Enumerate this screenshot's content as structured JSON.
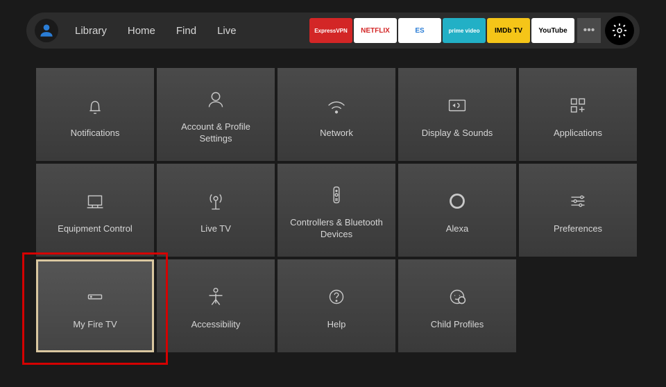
{
  "nav": {
    "items": [
      "Library",
      "Home",
      "Find",
      "Live"
    ]
  },
  "apps": [
    {
      "name": "ExpressVPN",
      "bg": "#d32626",
      "fg": "#ffffff"
    },
    {
      "name": "NETFLIX",
      "bg": "#ffffff",
      "fg": "#d32626"
    },
    {
      "name": "ES",
      "bg": "#ffffff",
      "fg": "#2a7dd6"
    },
    {
      "name": "prime video",
      "bg": "#22b0c6",
      "fg": "#ffffff"
    },
    {
      "name": "IMDb TV",
      "bg": "#f5c518",
      "fg": "#000000"
    },
    {
      "name": "YouTube",
      "bg": "#ffffff",
      "fg": "#000000"
    }
  ],
  "more_label": "•••",
  "tiles": [
    {
      "label": "Notifications",
      "icon": "bell"
    },
    {
      "label": "Account & Profile Settings",
      "icon": "user"
    },
    {
      "label": "Network",
      "icon": "wifi"
    },
    {
      "label": "Display & Sounds",
      "icon": "display"
    },
    {
      "label": "Applications",
      "icon": "apps"
    },
    {
      "label": "Equipment Control",
      "icon": "monitor"
    },
    {
      "label": "Live TV",
      "icon": "antenna"
    },
    {
      "label": "Controllers & Bluetooth Devices",
      "icon": "remote"
    },
    {
      "label": "Alexa",
      "icon": "alexa"
    },
    {
      "label": "Preferences",
      "icon": "sliders"
    },
    {
      "label": "My Fire TV",
      "icon": "device",
      "selected": true
    },
    {
      "label": "Accessibility",
      "icon": "person"
    },
    {
      "label": "Help",
      "icon": "help"
    },
    {
      "label": "Child Profiles",
      "icon": "child"
    }
  ],
  "selection_highlight_index": 10
}
